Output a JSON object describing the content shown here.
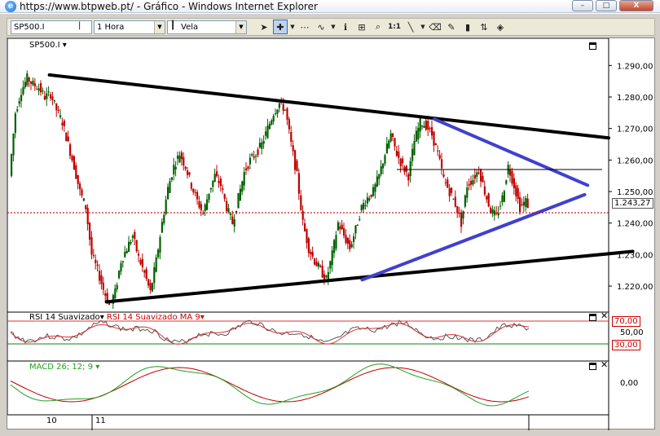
{
  "window": {
    "title": "https://www.btpweb.pt/ - Gráfico - Windows Internet Explorer",
    "min": "–",
    "max": "□",
    "close": "X"
  },
  "toolbar": {
    "symbol": "SP500.I",
    "timeframe": "1 Hora",
    "chart_style": "Vela",
    "zoom_label": "1:1"
  },
  "main_panel": {
    "label": "SP500.I",
    "y_ticks": [
      "1.290,00",
      "1.280,00",
      "1.270,00",
      "1.260,00",
      "1.250,00",
      "1.240,00",
      "1.230,00",
      "1.220,00"
    ],
    "current_price": "1.243,27"
  },
  "rsi_panel": {
    "label_a": "RSI 14 Suavizado",
    "label_b": "RSI 14 Suavizado MA 9",
    "levels": [
      "70,00",
      "50,00",
      "30,00"
    ]
  },
  "macd_panel": {
    "label": "MACD 26; 12; 9",
    "level": "0,00"
  },
  "x_axis": {
    "labels": [
      "10",
      "11"
    ]
  },
  "colors": {
    "candle_up": "#006000",
    "candle_down": "#c00000",
    "trendline": "#000000",
    "triangle": "#4040d0",
    "rsi_ma": "#e03030",
    "macd_signal": "#c00000",
    "macd_line": "#20a020"
  },
  "chart_data": {
    "type": "candlestick",
    "y_range": [
      1212,
      1295
    ],
    "price_path": [
      1255,
      1275,
      1282,
      1286,
      1284,
      1283,
      1280,
      1281,
      1276,
      1272,
      1265,
      1258,
      1250,
      1245,
      1230,
      1225,
      1219,
      1214,
      1218,
      1228,
      1232,
      1236,
      1229,
      1224,
      1218,
      1228,
      1240,
      1251,
      1258,
      1262,
      1258,
      1252,
      1247,
      1243,
      1250,
      1255,
      1252,
      1245,
      1240,
      1248,
      1256,
      1260,
      1262,
      1265,
      1270,
      1275,
      1278,
      1276,
      1265,
      1255,
      1240,
      1232,
      1228,
      1225,
      1222,
      1230,
      1240,
      1236,
      1232,
      1238,
      1245,
      1248,
      1250,
      1255,
      1262,
      1268,
      1262,
      1258,
      1255,
      1266,
      1272,
      1271,
      1268,
      1262,
      1254,
      1250,
      1246,
      1240,
      1252,
      1254,
      1257,
      1250,
      1244,
      1242,
      1248,
      1258,
      1252,
      1245,
      1247,
      1243.27
    ],
    "trendlines": [
      {
        "name": "upper-black",
        "from": [
          0.07,
          1287
        ],
        "to": [
          1.0,
          1267
        ]
      },
      {
        "name": "lower-black",
        "from": [
          0.165,
          1215
        ],
        "to": [
          1.04,
          1231
        ]
      },
      {
        "name": "triangle-upper",
        "from": [
          0.71,
          1273
        ],
        "to": [
          0.965,
          1252
        ]
      },
      {
        "name": "triangle-lower",
        "from": [
          0.59,
          1222
        ],
        "to": [
          0.96,
          1249
        ]
      }
    ],
    "horizontal_line": 1257
  }
}
